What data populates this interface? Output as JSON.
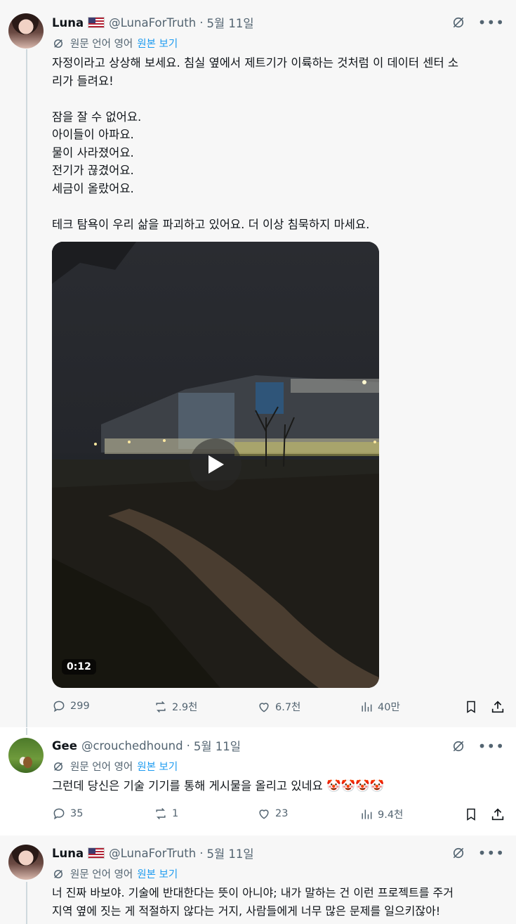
{
  "posts": [
    {
      "name": "Luna",
      "handle": "@LunaForTruth",
      "separator": "·",
      "date": "5월 11일",
      "translate": {
        "label": "원문 언어 영어",
        "link": "원본 보기"
      },
      "text": [
        "자정이라고 상상해 보세요. 침실 옆에서 제트기가 이륙하는 것처럼 이 데이터 센터 소",
        "리가 들려요!",
        "",
        "잠을 잘 수 없어요.",
        "아이들이 아파요.",
        "물이 사라졌어요.",
        "전기가 끊겼어요.",
        "세금이 올랐어요.",
        "",
        "테크 탐욕이 우리 삶을 파괴하고 있어요. 더 이상 침묵하지 마세요."
      ],
      "video": {
        "duration": "0:12"
      },
      "actions": {
        "replies": "299",
        "reposts": "2.9천",
        "likes": "6.7천",
        "views": "40만"
      }
    },
    {
      "name": "Gee",
      "handle": "@crouchedhound",
      "separator": "·",
      "date": "5월 11일",
      "translate": {
        "label": "원문 언어 영어",
        "link": "원본 보기"
      },
      "text": [
        "그런데 당신은 기술 기기를 통해 게시물을 올리고 있네요 🤡🤡🤡🤡"
      ],
      "actions": {
        "replies": "35",
        "reposts": "1",
        "likes": "23",
        "views": "9.4천"
      }
    },
    {
      "name": "Luna",
      "handle": "@LunaForTruth",
      "separator": "·",
      "date": "5월 11일",
      "translate": {
        "label": "원문 언어 영어",
        "link": "원본 보기"
      },
      "text": [
        "너 진짜 바보야. 기술에 반대한다는 뜻이 아니야; 내가 말하는 건 이런 프로젝트를 주거",
        "지역 옆에 짓는 게 적절하지 않다는 거지, 사람들에게 너무 많은 문제를 일으키잖아!"
      ]
    }
  ],
  "colors": {
    "link": "#1d9bf0",
    "secondary_text": "#536471",
    "primary_text": "#0f1419"
  },
  "icons": [
    "grok-icon",
    "more-icon",
    "translate-icon",
    "reply-icon",
    "repost-icon",
    "like-icon",
    "views-icon",
    "bookmark-icon",
    "share-icon",
    "play-icon"
  ]
}
